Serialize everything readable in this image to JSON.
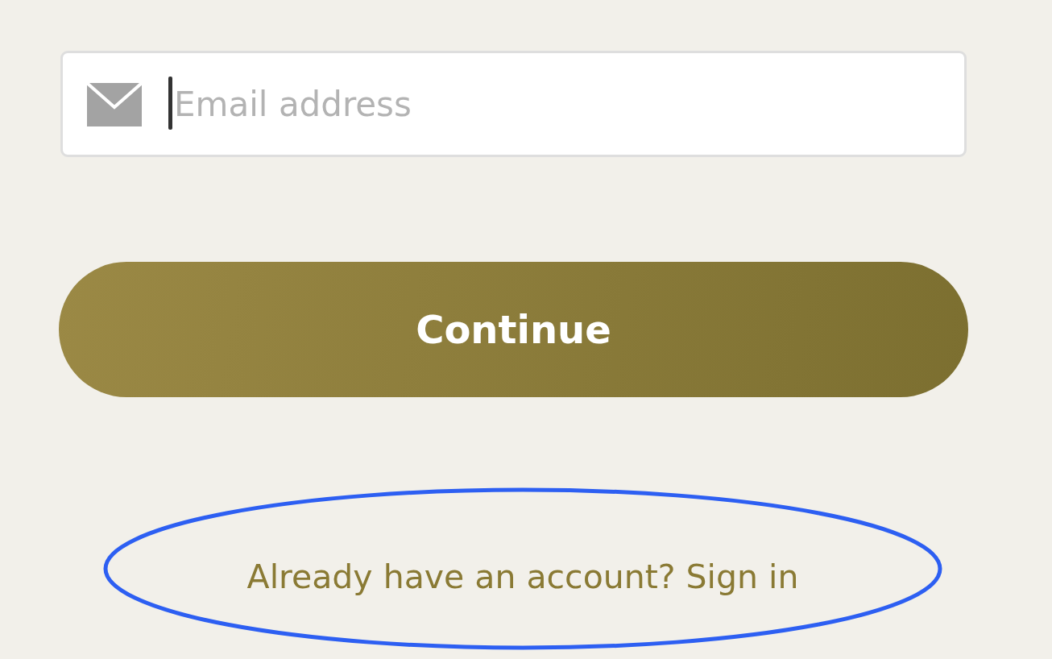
{
  "email_field": {
    "placeholder": "Email address",
    "focused": true
  },
  "continue_button": {
    "label": "Continue"
  },
  "sign_in_prompt": {
    "text": "Already have an account?",
    "link": "Sign in"
  },
  "annotation": {
    "kind": "ellipse"
  }
}
